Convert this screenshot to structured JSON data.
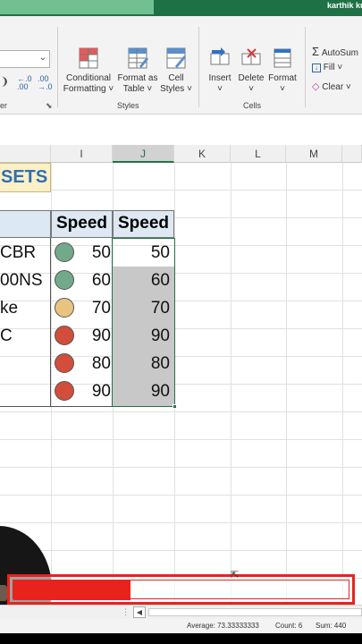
{
  "window": {
    "user_name": "karthik ku"
  },
  "ribbon": {
    "cond_format_label": "Conditional",
    "cond_format_label2": "Formatting ˅",
    "format_table_label": "Format as",
    "format_table_label2": "Table ˅",
    "cell_styles_label": "Cell",
    "cell_styles_label2": "Styles ˅",
    "insert_label": "Insert",
    "delete_label": "Delete",
    "format_label": "Format",
    "autosum_label": "AutoSum",
    "fill_label": "Fill ˅",
    "clear_label": "Clear ˅",
    "number_group_label": "er",
    "styles_group_label": "Styles",
    "cells_group_label": "Cells",
    "increase_decimal": "←.0\n.00",
    "decrease_decimal": ".00\n→.0"
  },
  "columns": [
    "I",
    "J",
    "K",
    "L",
    "M"
  ],
  "selected_column": "J",
  "sheet": {
    "sets_fragment": "SETS",
    "header_i": "Speed",
    "header_j": "Speed",
    "rows": [
      {
        "label": "CBR",
        "i": "50",
        "j": "50",
        "dot": "#72a98a"
      },
      {
        "label": "00NS",
        "i": "60",
        "j": "60",
        "dot": "#72a98a"
      },
      {
        "label": "ke",
        "i": "70",
        "j": "70",
        "dot": "#e8c47e"
      },
      {
        "label": "C",
        "i": "90",
        "j": "90",
        "dot": "#d24d3a"
      },
      {
        "label": "",
        "i": "80",
        "j": "80",
        "dot": "#d24d3a"
      },
      {
        "label": "",
        "i": "90",
        "j": "90",
        "dot": "#d24d3a"
      }
    ]
  },
  "overlay": {
    "progress": 0.35,
    "color": "#e8231e"
  },
  "status": {
    "average": "Average: 73.33333333",
    "count": "Count: 6",
    "sum": "Sum: 440"
  }
}
